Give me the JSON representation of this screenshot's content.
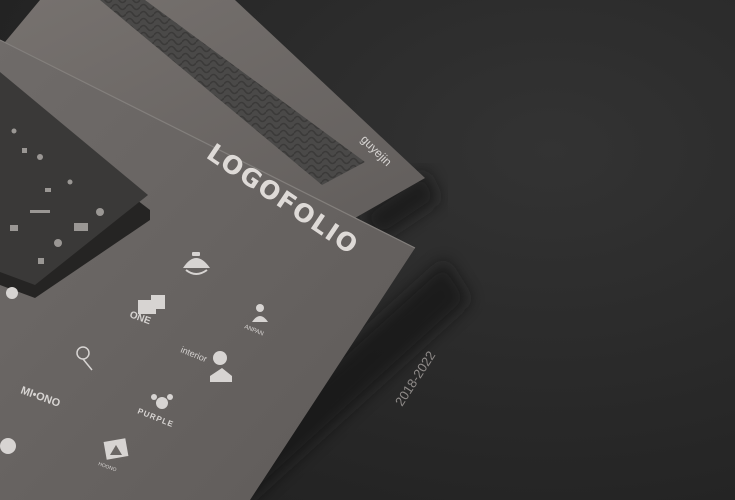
{
  "scene": {
    "brand": "guyejin",
    "title": "LOGOFOLIO",
    "years": "2018-2022",
    "logo_labels": {
      "one": "ONE",
      "anpan": "ANPAN",
      "interior": "interior",
      "mitono": "MI•ONO",
      "purple": "PURPLE",
      "hoono": "HOONO"
    },
    "colors": {
      "background": "#2b2b2b",
      "sheet_front": "#6d6967",
      "sheet_back": "#726e6c",
      "pattern_band": "#4a4948",
      "business_cards": "#3a3938",
      "print_ink": "#d7d4d2"
    }
  }
}
